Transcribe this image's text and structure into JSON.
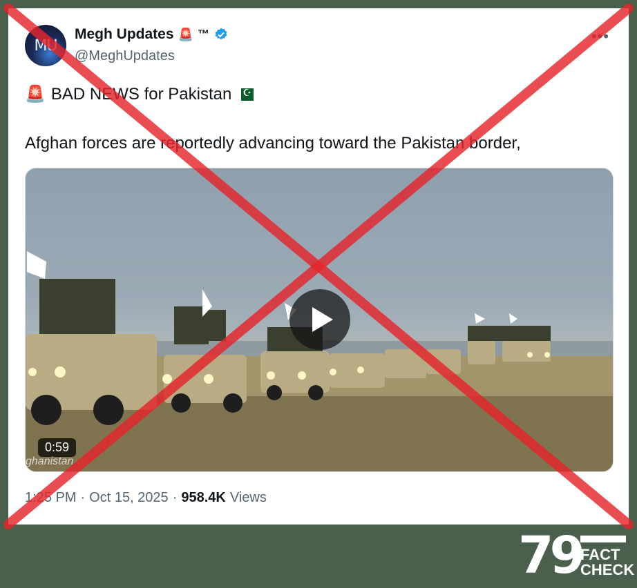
{
  "post": {
    "avatar_text": "MU",
    "display_name": "Megh Updates",
    "siren": "🚨",
    "tm": "™",
    "handle": "@MeghUpdates",
    "more": "•••",
    "headline_emoji": "🚨",
    "headline": "BAD NEWS for Pakistan",
    "body": "Afghan forces are reportedly advancing toward the Pakistan border,",
    "time": "1:25 PM",
    "separator": "·",
    "date": "Oct 15, 2025",
    "views_count": "958.4K",
    "views_label": "Views"
  },
  "media": {
    "duration": "0:59",
    "watermark": "ghanistan"
  },
  "overlay": {
    "cross_color": "#e4252b"
  },
  "logo": {
    "number": "79",
    "fact": "FACT",
    "check": "CHECK"
  }
}
